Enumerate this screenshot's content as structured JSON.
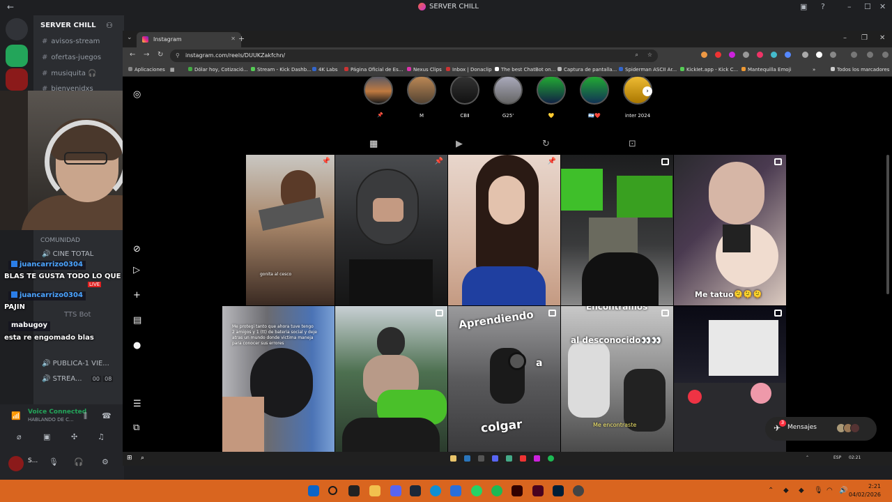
{
  "discord": {
    "title": "SERVER CHILL",
    "server_name": "SERVER CHILL",
    "channels": [
      "avisos-stream",
      "ofertas-juegos",
      "musiquita 🎧",
      "bienvenidxs"
    ],
    "category": "COMUNIDAD",
    "voice_channels": [
      "CINE TOTAL",
      "TTS Bot",
      "PUBLICA-1 VIE...",
      "STREA..."
    ],
    "voice_counts": [
      "00",
      "08"
    ],
    "voice_status": "Voice Connected",
    "voice_sub": "HABLANDO DE C...",
    "user_initial": "S..."
  },
  "chat": [
    {
      "user": "juancarrizo0304",
      "message": "BLAS TE GUSTA TODO LO QUE SE ASIMILE A UNA MUJER"
    },
    {
      "user": "juancarrizo0304",
      "message": "PAJIN"
    },
    {
      "user": "mabugoy",
      "message": "esta re engomado blas"
    }
  ],
  "chat_live_badge": "LIVE",
  "browser": {
    "tab_title": "Instagram",
    "url": "instagram.com/reels/DUUKZakfchn/",
    "bookmarks": [
      "Aplicaciones",
      "Dólar hoy, Cotizació...",
      "Stream - Kick Dashb...",
      "4K Labs",
      "Página Oficial de Es...",
      "Nexus Clips",
      "Inbox | Donaclip",
      "The best ChatBot on...",
      "Captura de pantalla...",
      "Spiderman ASCII Ar...",
      "KickIet.app - Kick C...",
      "Mantequilla Emoji",
      "Todos los marcadores"
    ]
  },
  "instagram": {
    "highlights": [
      "",
      "M",
      "CBⅡ",
      "G25'",
      "💛",
      "🇦🇷❤️",
      "inter 2024"
    ],
    "posts": [
      {
        "caption": "gonita al cesco",
        "badge": "pin"
      },
      {
        "caption": "",
        "badge": "pin"
      },
      {
        "caption": "",
        "badge": "pin"
      },
      {
        "caption": "",
        "badge": "reel"
      },
      {
        "caption": "Me tatuo🫠🫠🫠",
        "badge": "reel"
      },
      {
        "caption": "Me protegi tanto que ahora tuve tengo 2 amigos y 1 (tt) de bateria social y deje atras un mundo donde victima maneja para conocer sus errores",
        "badge": ""
      },
      {
        "caption": "",
        "badge": "reel"
      },
      {
        "caption": "Aprendiendo a colgar",
        "badge": "reel"
      },
      {
        "caption": "Encontramos al desconocido👀👀 Me encontraste",
        "badge": "reel"
      },
      {
        "caption": "",
        "badge": "reel"
      }
    ],
    "post6_lines": [
      "Me protegi tanto que ahora tuve tengo",
      "2 amigos y 1 (tt) de bateria social y deje",
      "atras un mundo donde victima maneja",
      "para conocer sus errores"
    ],
    "post8_lines": [
      "Aprendiendo",
      "a",
      "colgar"
    ],
    "post9_lines": [
      "Encontramos",
      "al desconocido👀👀",
      "Me encontraste"
    ],
    "messages_label": "Mensajes",
    "messages_badge": "3"
  },
  "inner_taskbar": {
    "lang": "ESP",
    "time": "02:21"
  },
  "taskbar": {
    "time": "2:21",
    "date": "04/02/2026"
  },
  "colors": {
    "discord_bg": "#1e1f22",
    "taskbar": "#d9651f",
    "ig_bg": "#000000",
    "accent_green": "#23a55a"
  }
}
